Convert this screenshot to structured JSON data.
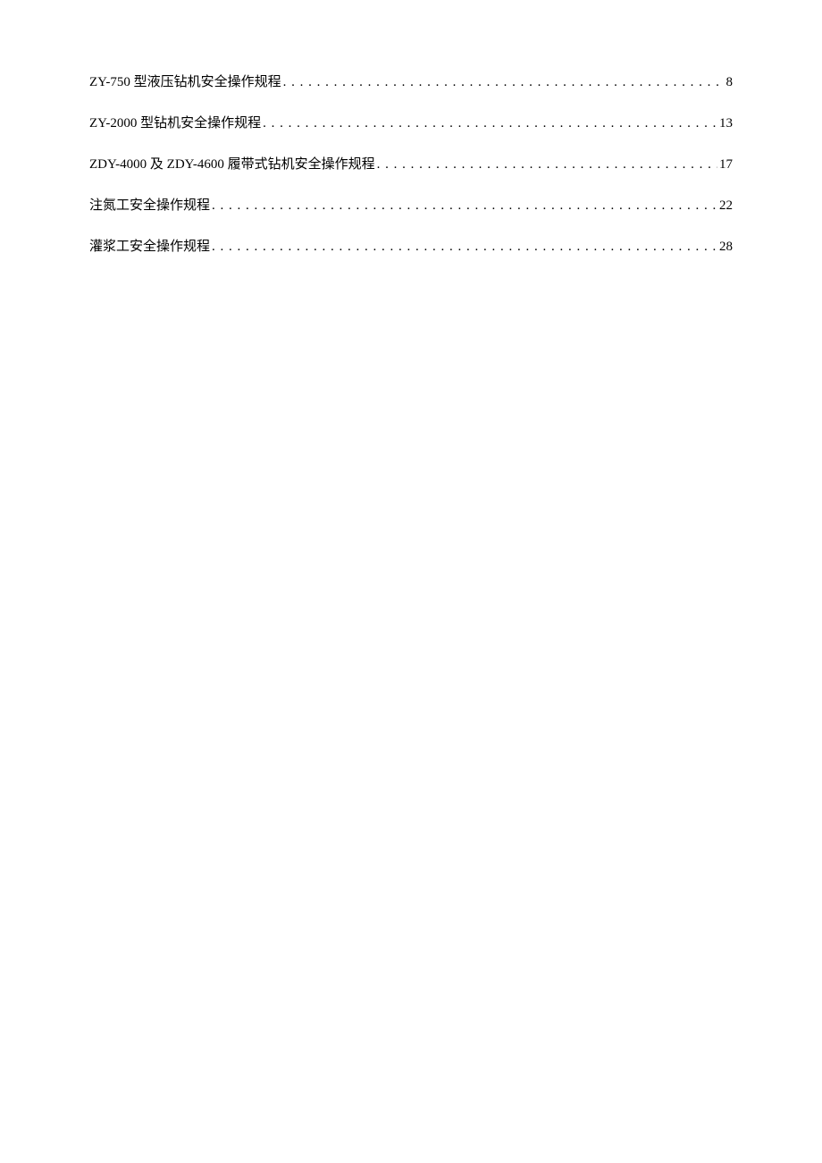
{
  "toc": {
    "entries": [
      {
        "title": "ZY-750 型液压钻机安全操作规程",
        "page": "8"
      },
      {
        "title": "ZY-2000 型钻机安全操作规程",
        "page": "13"
      },
      {
        "title": "ZDY-4000 及 ZDY-4600 履带式钻机安全操作规程",
        "page": "17"
      },
      {
        "title": "注氮工安全操作规程",
        "page": "22"
      },
      {
        "title": "灌浆工安全操作规程",
        "page": "28"
      }
    ]
  }
}
